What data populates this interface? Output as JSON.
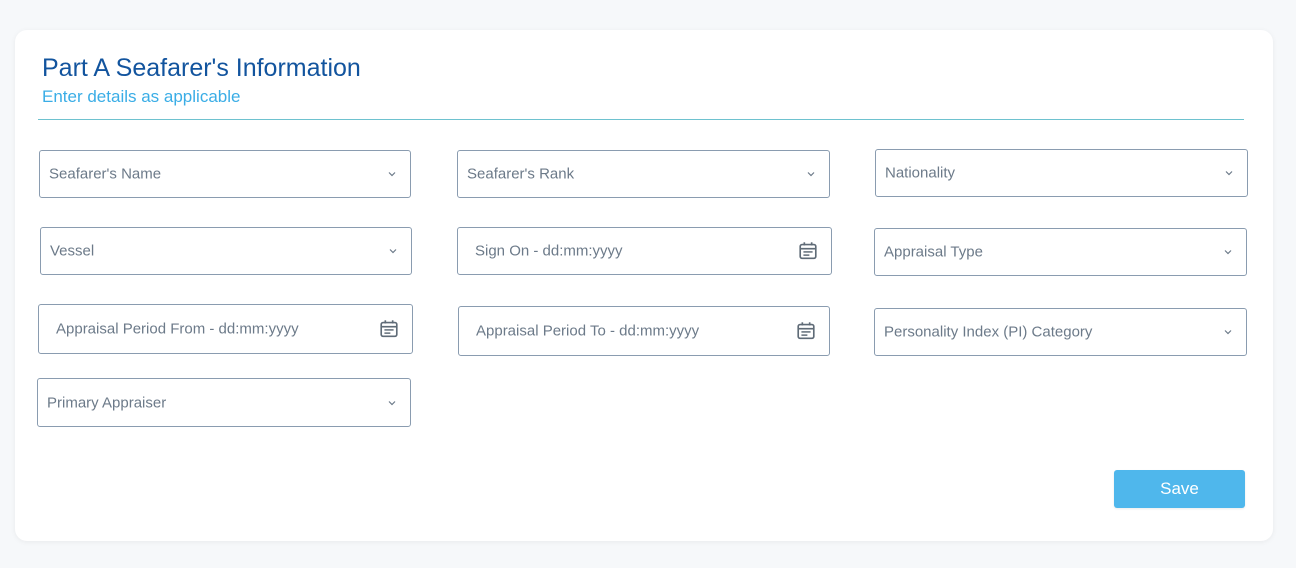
{
  "form": {
    "title": "Part A Seafarer's Information",
    "subtitle": "Enter details as applicable",
    "fields": {
      "seafarer_name": {
        "label": "Seafarer's Name",
        "icon": "chevron-down-icon"
      },
      "seafarer_rank": {
        "label": "Seafarer's Rank",
        "icon": "chevron-down-icon"
      },
      "nationality": {
        "label": "Nationality",
        "icon": "chevron-down-icon"
      },
      "vessel": {
        "label": "Vessel",
        "icon": "chevron-down-icon"
      },
      "sign_on": {
        "label": "Sign On - dd:mm:yyyy",
        "icon": "calendar-icon"
      },
      "appraisal_type": {
        "label": "Appraisal Type",
        "icon": "chevron-down-icon"
      },
      "appraisal_from": {
        "label": "Appraisal Period From - dd:mm:yyyy",
        "icon": "calendar-icon"
      },
      "appraisal_to": {
        "label": "Appraisal Period To - dd:mm:yyyy",
        "icon": "calendar-icon"
      },
      "pi_category": {
        "label": "Personality Index (PI) Category",
        "icon": "chevron-down-icon"
      },
      "primary_appraiser": {
        "label": "Primary Appraiser",
        "icon": "chevron-down-icon"
      }
    },
    "save_label": "Save"
  },
  "colors": {
    "title": "#12549e",
    "subtitle": "#3aade6",
    "divider": "#6ec2cf",
    "field_border": "#8a9cb0",
    "placeholder": "#6c7a89",
    "button": "#4fb7ec"
  }
}
